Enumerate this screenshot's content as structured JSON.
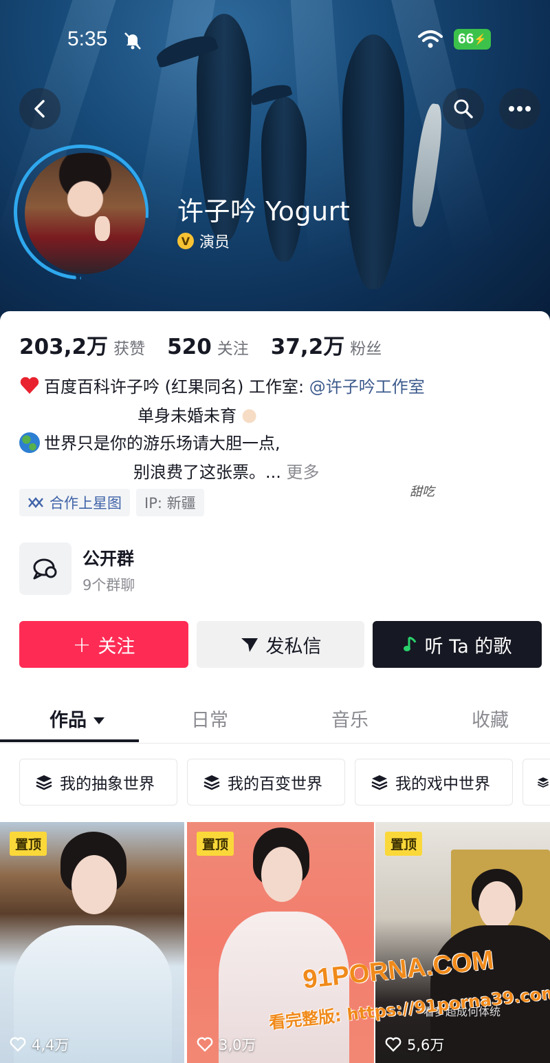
{
  "status_bar": {
    "time": "5:35",
    "battery": "66"
  },
  "profile": {
    "name": "许子吟 Yogurt",
    "verification": "演员",
    "stats": [
      {
        "value": "203,2万",
        "label": "获赞"
      },
      {
        "value": "520",
        "label": "关注"
      },
      {
        "value": "37,2万",
        "label": "粉丝"
      }
    ],
    "bio": {
      "line1_text": "百度百科许子吟 (红果同名) 工作室: ",
      "line1_mention": "@许子吟工作室",
      "line2": "单身未婚未育",
      "line3": "世界只是你的游乐场请大胆一点,",
      "line4_text": "别浪费了这张票。... ",
      "line4_more": "更多"
    },
    "tags": {
      "star": "合作上星图",
      "ip": "IP: 新疆"
    },
    "signature": "甜吃"
  },
  "group": {
    "title": "公开群",
    "subtitle": "9个群聊"
  },
  "actions": {
    "follow": "关注",
    "message": "发私信",
    "song": "听 Ta 的歌"
  },
  "tabs": [
    {
      "label": "作品",
      "active": true
    },
    {
      "label": "日常"
    },
    {
      "label": "音乐"
    },
    {
      "label": "收藏"
    }
  ],
  "collections": [
    "我的抽象世界",
    "我的百变世界",
    "我的戏中世界"
  ],
  "videos": [
    {
      "badge": "置顶",
      "likes": "4,4万"
    },
    {
      "badge": "置顶",
      "likes": "3,0万"
    },
    {
      "badge": "置顶",
      "likes": "5,6万",
      "caption": "看梦超成何体统"
    }
  ],
  "watermark": {
    "logo": "91PORNA.COM",
    "text": "看完整版: https://91porna39.com"
  },
  "colors": {
    "primary": "#fe2c55",
    "dark": "#161823",
    "mention": "#3c5a8c",
    "tag_star": "#3f63a8",
    "verify": "#f7c233"
  }
}
